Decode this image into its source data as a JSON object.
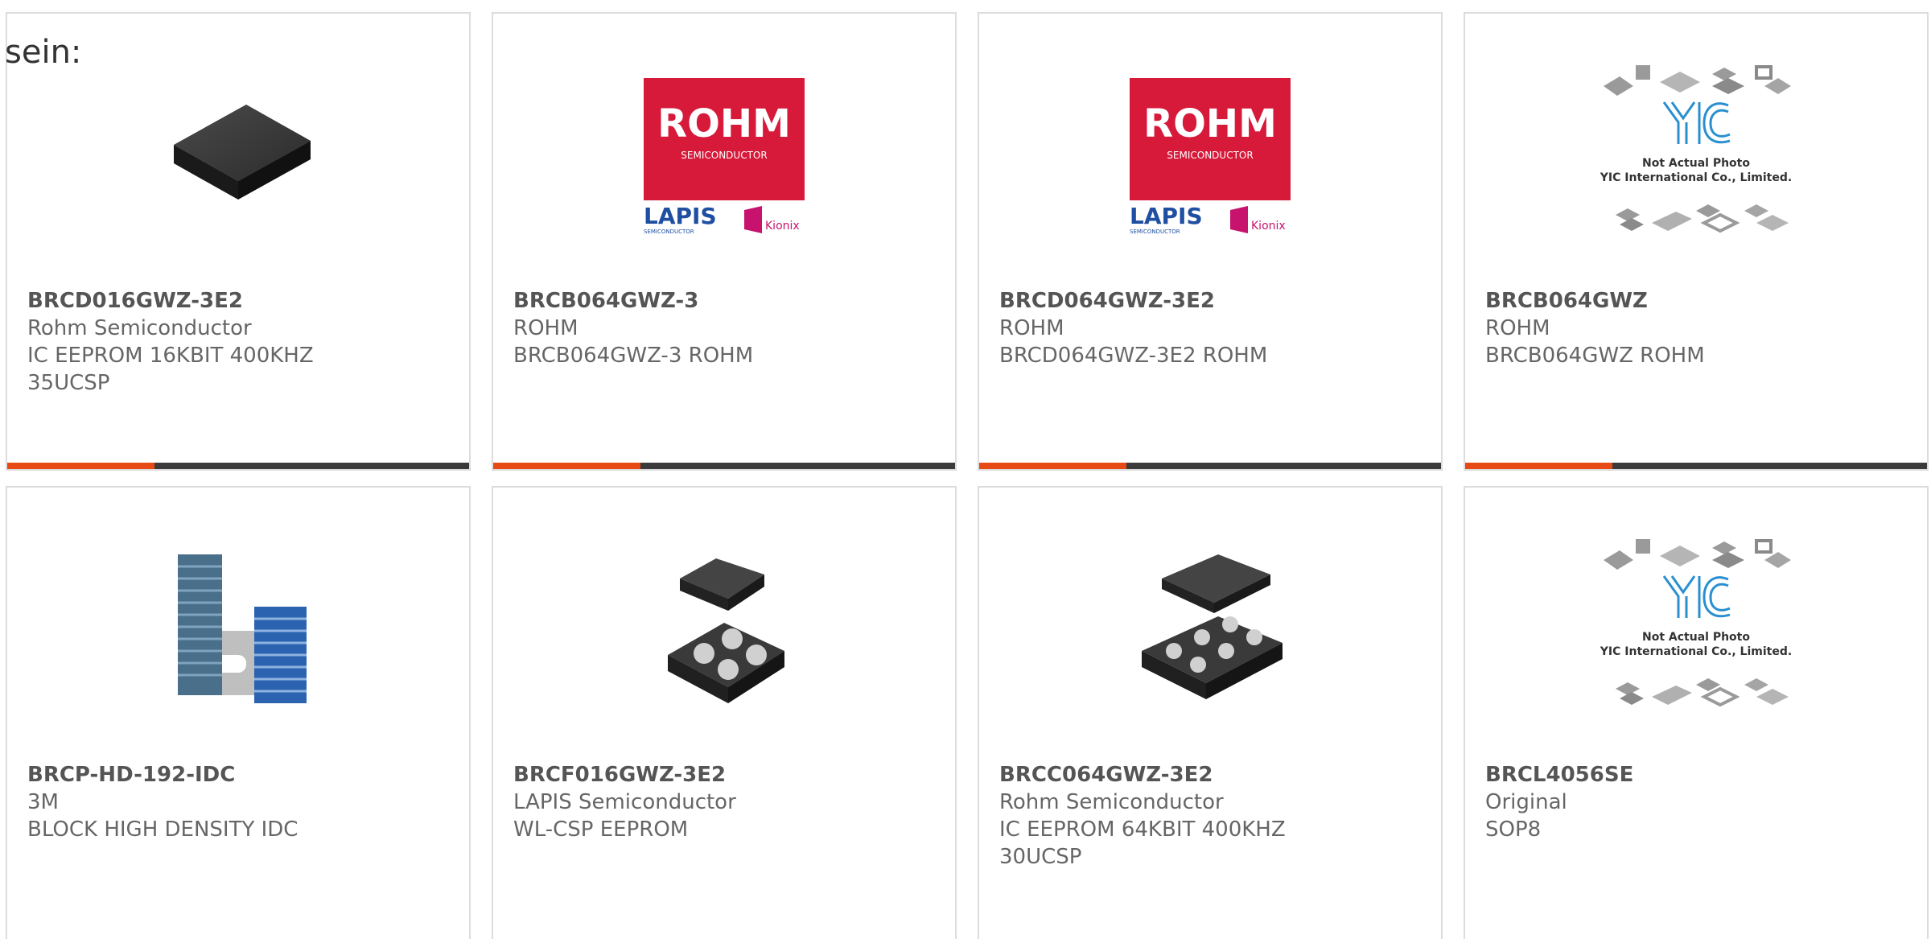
{
  "intro_text": "sein:",
  "colors": {
    "accent": "#e84a16",
    "bar": "#3a3a3a",
    "border": "#dcdcdc",
    "rohm_red": "#d7193a",
    "lapis_blue": "#1f4fa0",
    "kionix_pink": "#c8136e"
  },
  "logos": {
    "rohm": "ROHM",
    "semiconductor": "SEMICONDUCTOR",
    "lapis": "LAPIS",
    "lapis_sub": "SEMICONDUCTOR",
    "kionix": "Kionix",
    "yic_line1": "Not Actual Photo",
    "yic_line2": "YIC International Co., Limited."
  },
  "products": [
    {
      "part": "BRCD016GWZ-3E2",
      "maker": "Rohm Semiconductor",
      "desc1": "IC EEPROM 16KBIT 400KHZ",
      "desc2": "35UCSP",
      "image": "black-chip-package"
    },
    {
      "part": "BRCB064GWZ-3",
      "maker": "ROHM",
      "desc1": "BRCB064GWZ-3 ROHM",
      "desc2": "",
      "image": "rohm-lapis-logo"
    },
    {
      "part": "BRCD064GWZ-3E2",
      "maker": "ROHM",
      "desc1": "BRCD064GWZ-3E2 ROHM",
      "desc2": "",
      "image": "rohm-lapis-logo"
    },
    {
      "part": "BRCB064GWZ",
      "maker": "ROHM",
      "desc1": "BRCB064GWZ ROHM",
      "desc2": "",
      "image": "yic-placeholder"
    },
    {
      "part": "BRCP-HD-192-IDC",
      "maker": "3M",
      "desc1": "BLOCK HIGH DENSITY IDC",
      "desc2": "",
      "image": "idc-connector-block"
    },
    {
      "part": "BRCF016GWZ-3E2",
      "maker": "LAPIS Semiconductor",
      "desc1": "WL-CSP EEPROM",
      "desc2": "",
      "image": "wlcsp-chip-4ball"
    },
    {
      "part": "BRCC064GWZ-3E2",
      "maker": "Rohm Semiconductor",
      "desc1": "IC EEPROM 64KBIT 400KHZ",
      "desc2": "30UCSP",
      "image": "ucsp-chip-6ball"
    },
    {
      "part": "BRCL4056SE",
      "maker": "Original",
      "desc1": "SOP8",
      "desc2": "",
      "image": "yic-placeholder"
    }
  ]
}
